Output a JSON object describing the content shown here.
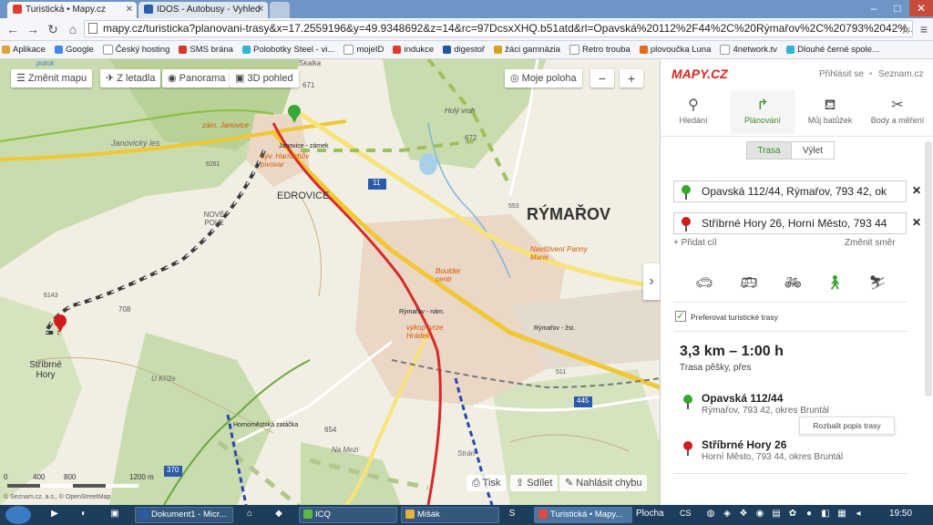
{
  "browser": {
    "tabs": [
      {
        "title": "Turistická • Mapy.cz",
        "active": true
      },
      {
        "title": "IDOS - Autobusy - Vyhled",
        "active": false
      }
    ],
    "url": "mapy.cz/turisticka?planovani-trasy&x=17.2559196&y=49.9348692&z=14&rc=97DcsxXHQ.b51atd&rl=Opavská%20112%2F44%2C%20Rýmařov%2C%20793%2042%...",
    "bookmarks": [
      "Aplikace",
      "Google",
      "Český hosting",
      "SMS brána",
      "Polobotky Steel - vi...",
      "mojeID",
      "indukce",
      "digestoř",
      "žáci gamnázia",
      "Retro trouba",
      "plovoučka Luna",
      "4network.tv",
      "Dlouhé černé spole..."
    ]
  },
  "map": {
    "toolbar": {
      "change_map": "Změnit mapu",
      "from_plane": "Z letadla",
      "panorama": "Panorama",
      "view_3d": "3D pohled",
      "my_position": "Moje poloha",
      "zoom_out": "−",
      "zoom_in": "+"
    },
    "labels": {
      "rymarov": "RÝMAŘOV",
      "edrovice": "EDROVICE",
      "nove_pole": "NOVÉ POLE",
      "stribrne_hory": "Stříbrné Hory",
      "janovicky_les": "Janovický les",
      "skalka": "Skalka",
      "h671": "671",
      "holy_vrch": "Holý vrch",
      "h672": "672",
      "zam_janovice": "zám. Janovice",
      "janovice_zamek": "Janovice - zámek",
      "harrachuv": "býv. Harrachův pivovar",
      "boulder": "Boulder centr",
      "navstiveni": "Navštívení Panny Marie",
      "vykop": "výkop tvrze Hrádek",
      "rymarov_nam": "Rýmařov - nám.",
      "rymarov_zst": "Rýmařov - žst.",
      "hornomestska": "Hornoměstská zatáčka",
      "u_krize": "U Kříže",
      "na_mezi": "Na Mezi",
      "stran": "Strán",
      "h708": "708",
      "h654": "654",
      "potok": "potok",
      "r6261": "6261",
      "r11": "11",
      "r553": "553",
      "r445": "445",
      "r511": "511",
      "r370": "370",
      "r6143": "6143"
    },
    "scale": {
      "ticks": [
        "0",
        "400",
        "800",
        "1200 m"
      ]
    },
    "copyright": "© Seznam.cz, a.s., © OpenStreetMap",
    "bottom_actions": {
      "print": "Tisk",
      "share": "Sdílet",
      "report": "Nahlásit chybu"
    },
    "collapse": "›"
  },
  "panel": {
    "logo": "MAPY.CZ",
    "login": "Přihlásit se",
    "seznam": "Seznam.cz",
    "tabs": [
      "Hledání",
      "Plánování",
      "Můj batůžek",
      "Body a měření"
    ],
    "seg": [
      "Trasa",
      "Výlet"
    ],
    "start": "Opavská 112/44, Rýmařov, 793 42, ok",
    "end": "Stříbrné Hory 26, Horní Město, 793 44",
    "add_stop": "+ Přidat cíl",
    "reverse": "Změnit směr",
    "prefer": "Preferovat turistické trasy",
    "summary": "3,3 km – 1:00 h",
    "summary_sub": "Trasa pěšky, přes",
    "expand": "Rozbalit popis trasy",
    "stops": [
      {
        "title": "Opavská 112/44",
        "sub": "Rýmařov, 793 42, okres Bruntál"
      },
      {
        "title": "Stříbrné Hory 26",
        "sub": "Horní Město, 793 44, okres Bruntál"
      }
    ]
  },
  "taskbar": {
    "items": [
      "Dokument1 - Micr...",
      "ICQ",
      "Mišák",
      "Turistická • Mapy..."
    ],
    "desktop": "Plocha",
    "lang": "CS",
    "time": "19:50"
  }
}
